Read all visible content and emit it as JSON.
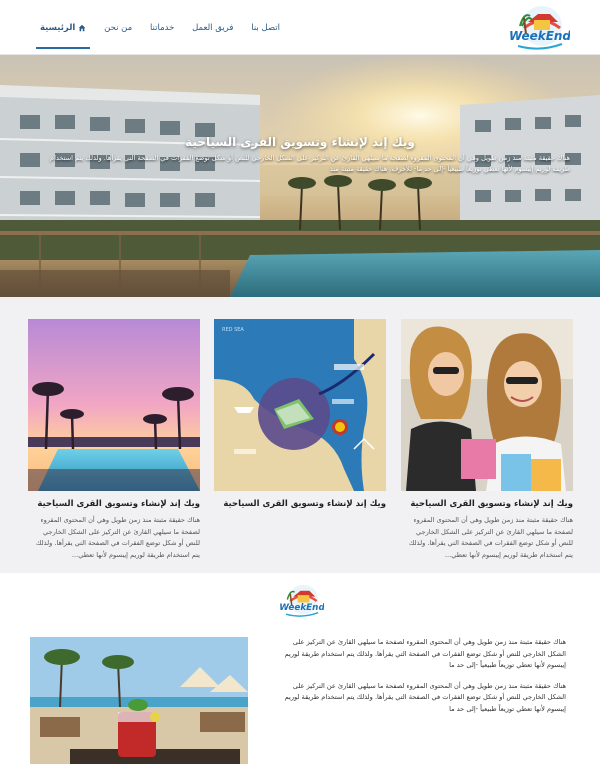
{
  "nav": {
    "items": [
      {
        "label": "الرئيسية",
        "active": true,
        "icon": "home-icon"
      },
      {
        "label": "من نحن"
      },
      {
        "label": "خدماتنا"
      },
      {
        "label": "فريق العمل"
      },
      {
        "label": "اتصل بنا"
      }
    ]
  },
  "logo": {
    "text": "WeekEnd"
  },
  "hero": {
    "title": "ويك إند لإنشاء وتسويق القرى السياحية",
    "text": "هناك حقيقة مثبتة منذ زمن طويل وهي أن المحتوى المقروء لصفحة ما سيلهي القارئ عن التركيز على الشكل الخارجي للنص أو شكل توضع الفقرات في الصفحة التي يقرأها. ولذلك يتم استخدام طريقة لوريم إيبسوم لأنها تعطي توزيعاً طبيعياً -إلى حد ما- للأحرف. هناك حقيقة مثبتة منذ"
  },
  "cards": [
    {
      "title": "ويك إند لإنشاء وتسويق القرى السياحية",
      "text": "هناك حقيقة مثبتة منذ زمن طويل وهي أن المحتوى المقروء لصفحة ما سيلهي القارئ عن التركيز على الشكل الخارجي للنص أو شكل توضع الفقرات في الصفحة التي يقرأها. ولذلك يتم استخدام طريقة لوريم إيبسوم لأنها تعطي..."
    },
    {
      "title": "ويك إند لإنشاء وتسويق القرى السياحية",
      "text": ""
    },
    {
      "title": "ويك إند لإنشاء وتسويق القرى السياحية",
      "text": "هناك حقيقة مثبتة منذ زمن طويل وهي أن المحتوى المقروء لصفحة ما سيلهي القارئ عن التركيز على الشكل الخارجي للنص أو شكل توضع الفقرات في الصفحة التي يقرأها. ولذلك يتم استخدام طريقة لوريم إيبسوم لأنها تعطي..."
    }
  ],
  "map": {
    "sea_label": "RED SEA"
  },
  "about": {
    "p1": "هناك حقيقة مثبتة منذ زمن طويل وهي أن المحتوى المقروء لصفحة ما سيلهي القارئ عن التركيز على الشكل الخارجي للنص أو شكل توضع الفقرات في الصفحة التي يقرأها. ولذلك يتم استخدام طريقة لوريم إيبسوم لأنها تعطي توزيعاً طبيعياً -إلى حد ما",
    "p2": "هناك حقيقة مثبتة منذ زمن طويل وهي أن المحتوى المقروء لصفحة ما سيلهي القارئ عن التركيز على الشكل الخارجي للنص أو شكل توضع الفقرات في الصفحة التي يقرأها. ولذلك يتم استخدام طريقة لوريم إيبسوم لأنها تعطي توزيعاً طبيعياً -إلى حد ما"
  },
  "colors": {
    "nav_text": "#2a5b86",
    "accent": "#2a6aa3",
    "section_bg": "#f1f1f4"
  }
}
